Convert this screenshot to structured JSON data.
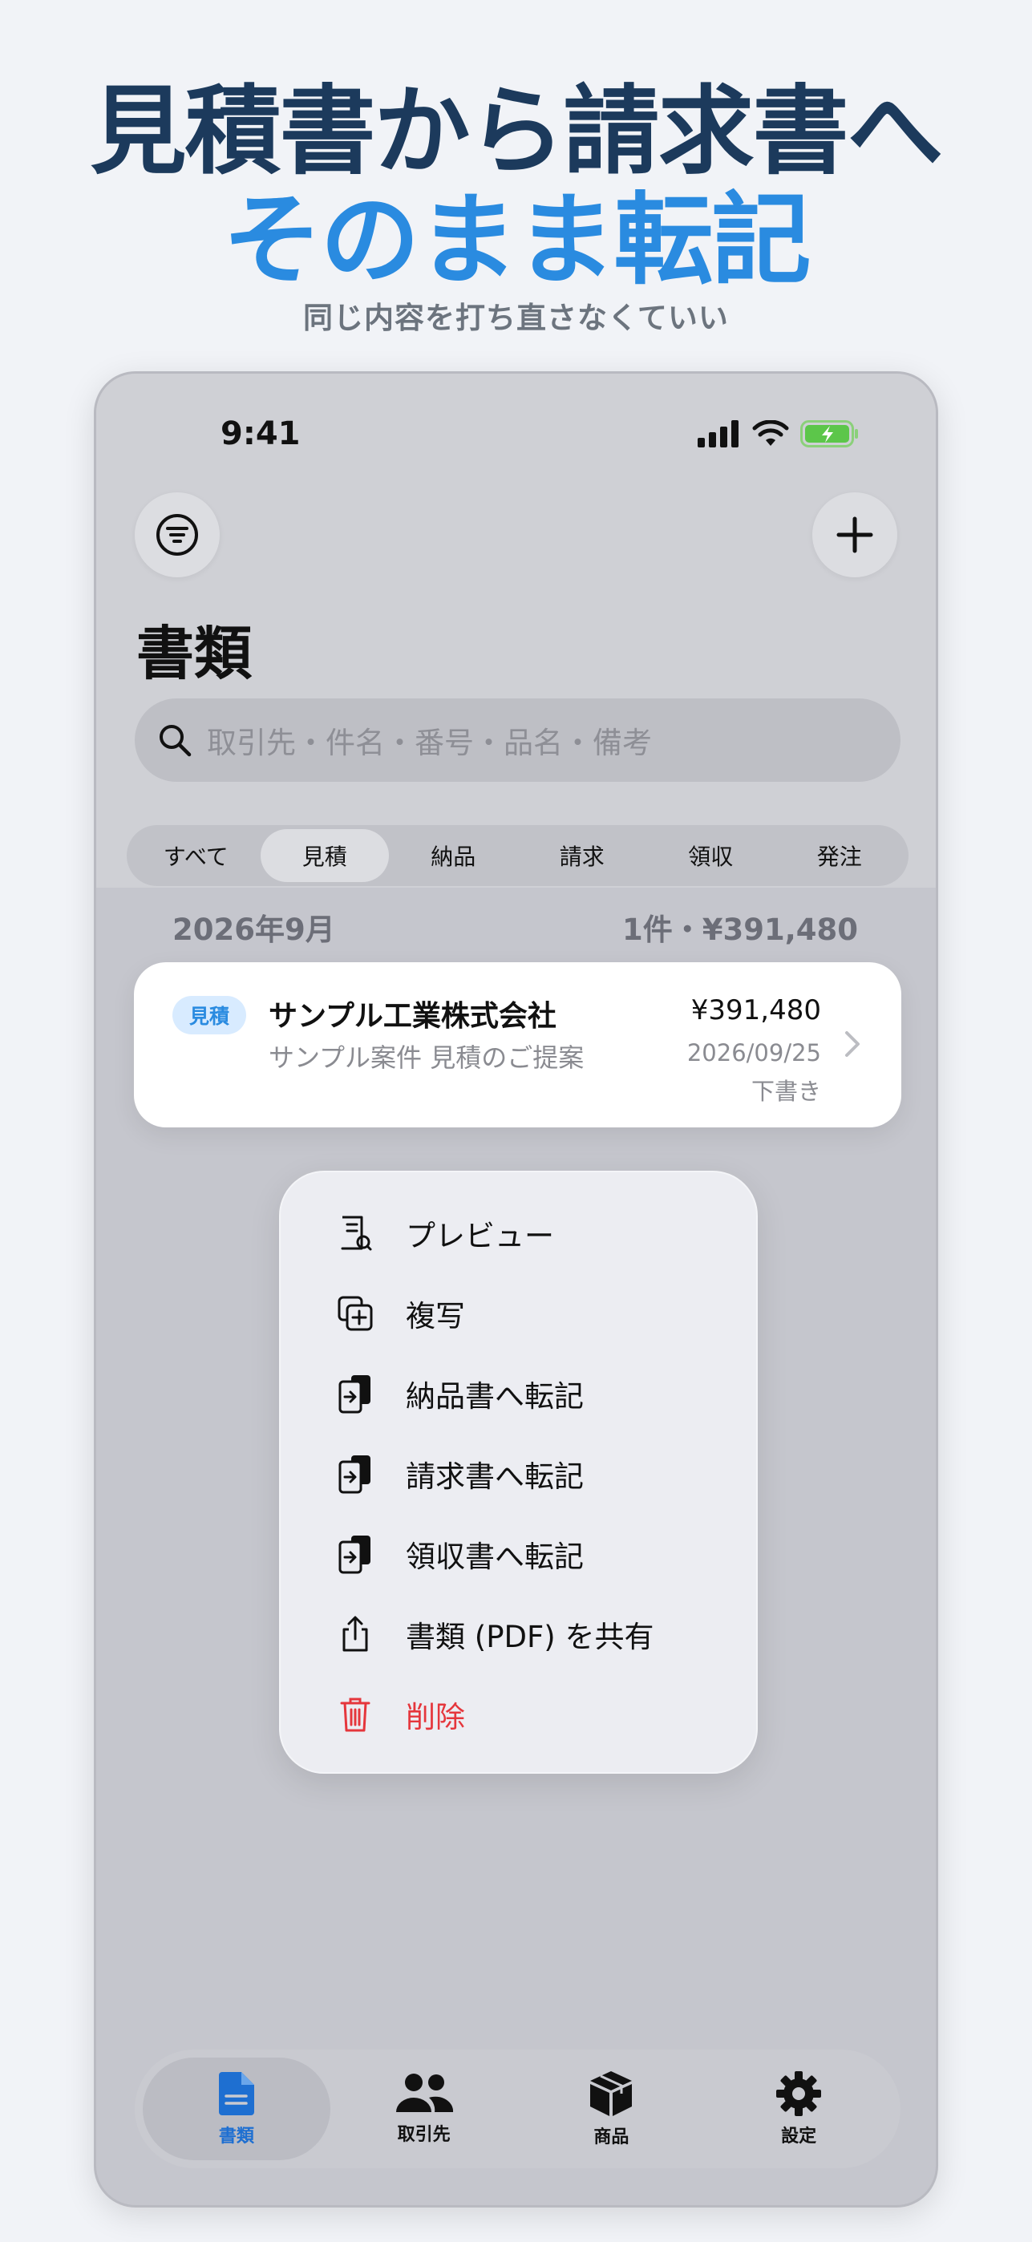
{
  "promo": {
    "headline_1": "見積書から請求書へ",
    "headline_2": "そのまま転記",
    "subheadline": "同じ内容を打ち直さなくていい"
  },
  "status_bar": {
    "time": "9:41"
  },
  "header": {
    "title": "書類"
  },
  "search": {
    "placeholder": "取引先・件名・番号・品名・備考"
  },
  "segments": [
    {
      "label": "すべて",
      "active": false
    },
    {
      "label": "見積",
      "active": true
    },
    {
      "label": "納品",
      "active": false
    },
    {
      "label": "請求",
      "active": false
    },
    {
      "label": "領収",
      "active": false
    },
    {
      "label": "発注",
      "active": false
    }
  ],
  "section": {
    "month": "2026年9月",
    "summary": "1件・¥391,480"
  },
  "document": {
    "badge": "見積",
    "client": "サンプル工業株式会社",
    "subject": "サンプル案件 見積のご提案",
    "amount": "¥391,480",
    "date": "2026/09/25",
    "status": "下書き"
  },
  "context_menu": [
    {
      "label": "プレビュー",
      "icon": "preview-document-icon"
    },
    {
      "label": "複写",
      "icon": "duplicate-icon"
    },
    {
      "label": "納品書へ転記",
      "icon": "transfer-document-icon"
    },
    {
      "label": "請求書へ転記",
      "icon": "transfer-document-icon"
    },
    {
      "label": "領収書へ転記",
      "icon": "transfer-document-icon"
    },
    {
      "label": "書類 (PDF) を共有",
      "icon": "share-icon"
    },
    {
      "label": "削除",
      "icon": "trash-icon",
      "destructive": true
    }
  ],
  "tabbar": [
    {
      "label": "書類",
      "icon": "document-icon",
      "active": true
    },
    {
      "label": "取引先",
      "icon": "people-icon",
      "active": false
    },
    {
      "label": "商品",
      "icon": "box-icon",
      "active": false
    },
    {
      "label": "設定",
      "icon": "gear-icon",
      "active": false
    }
  ],
  "colors": {
    "headline_dark": "#1c3a5c",
    "headline_accent": "#2a8be0",
    "destructive": "#e5363c",
    "tab_active": "#1e6fd1"
  }
}
